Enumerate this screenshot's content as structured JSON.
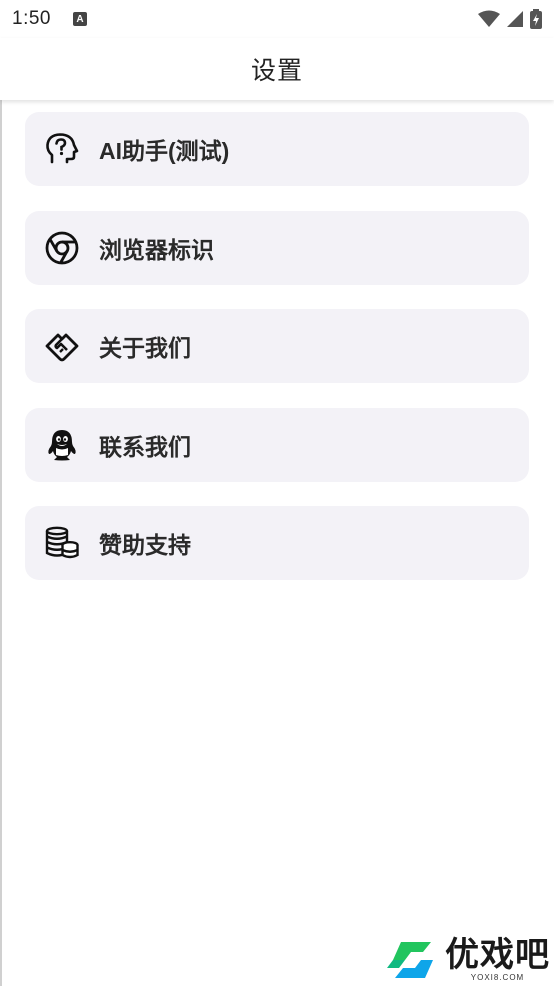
{
  "status_bar": {
    "time": "1:50",
    "notification_glyph": "A"
  },
  "app_bar": {
    "title": "设置"
  },
  "menu": [
    {
      "label": "AI助手(测试)",
      "icon": "ai-head-icon"
    },
    {
      "label": "浏览器标识",
      "icon": "chrome-icon"
    },
    {
      "label": "关于我们",
      "icon": "handshake-icon"
    },
    {
      "label": "联系我们",
      "icon": "qq-penguin-icon"
    },
    {
      "label": "赞助支持",
      "icon": "coins-icon"
    }
  ],
  "watermark": {
    "main": "优戏吧",
    "sub": "YOXI8.COM"
  },
  "colors": {
    "card_bg": "#f3f2f7",
    "accent_green": "#22c55e",
    "accent_blue": "#0ea5e9"
  }
}
